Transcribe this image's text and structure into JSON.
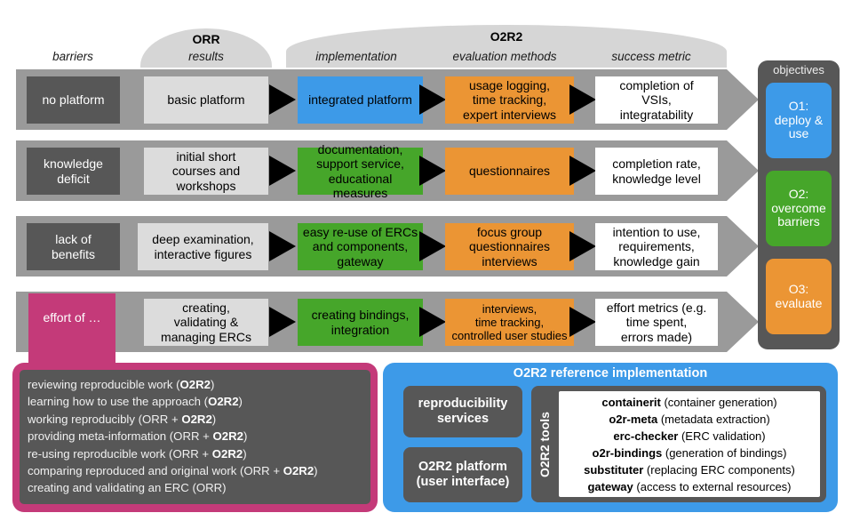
{
  "headers": {
    "groups": [
      {
        "label": "ORR"
      },
      {
        "label": "O2R2"
      }
    ],
    "columns": [
      {
        "label": "barriers"
      },
      {
        "label": "results"
      },
      {
        "label": "implementation"
      },
      {
        "label": "evaluation methods"
      },
      {
        "label": "success metric"
      }
    ]
  },
  "colors": {
    "blue": "#3d9ae8",
    "green": "#46a62a",
    "orange": "#eb9534",
    "magenta": "#c43a79",
    "dark_gray": "#575757",
    "light_gray": "#dcdcdc",
    "band_gray": "#9a9a9a",
    "hill_gray": "#d6d6d6"
  },
  "rows": [
    {
      "barrier": "no platform",
      "result": "basic platform",
      "implementation": "integrated platform",
      "evaluation": "usage logging,\ntime tracking,\nexpert interviews",
      "metric": "completion of\nVSIs,\nintegratability"
    },
    {
      "barrier": "knowledge\ndeficit",
      "result": "initial short\ncourses and\nworkshops",
      "implementation": "documentation,\nsupport service,\neducational measures",
      "evaluation": "questionnaires",
      "metric": "completion rate,\nknowledge level"
    },
    {
      "barrier": "lack of\nbenefits",
      "result": "deep examination,\ninteractive figures",
      "implementation": "easy re-use of ERCs\nand components,\ngateway",
      "evaluation": "focus group\nquestionnaires\ninterviews",
      "metric": "intention to use,\nrequirements,\nknowledge gain"
    },
    {
      "barrier": "effort of …",
      "result": "creating,\nvalidating &\nmanaging ERCs",
      "implementation": "creating bindings,\nintegration",
      "evaluation": "interviews,\ntime tracking,\ncontrolled user studies",
      "metric": "effort metrics (e.g.\ntime spent,\nerrors made)"
    }
  ],
  "objectives": {
    "title": "objectives",
    "items": [
      {
        "label": "O1:\ndeploy &\nuse",
        "color": "#3d9ae8"
      },
      {
        "label": "O2:\novercome\nbarriers",
        "color": "#46a62a"
      },
      {
        "label": "O3:\nevaluate",
        "color": "#eb9534"
      }
    ]
  },
  "effort_panel": {
    "items": [
      {
        "text": "reviewing reproducible work (",
        "bold": "O2R2",
        "tail": ")"
      },
      {
        "text": "learning how to use the approach (",
        "bold": "O2R2",
        "tail": ")"
      },
      {
        "text": "working reproducibly (ORR + ",
        "bold": "O2R2",
        "tail": ")"
      },
      {
        "text": "providing meta-information (ORR + ",
        "bold": "O2R2",
        "tail": ")"
      },
      {
        "text": "re-using reproducible work (ORR + ",
        "bold": "O2R2",
        "tail": ")"
      },
      {
        "text": "comparing reproduced and original work (ORR + ",
        "bold": "O2R2",
        "tail": ")"
      },
      {
        "text": "creating and validating an ERC (ORR)",
        "bold": "",
        "tail": ""
      }
    ]
  },
  "reference_implementation": {
    "title": "O2R2 reference implementation",
    "services_label": "reproducibility\nservices",
    "platform_label": "O2R2 platform\n(user interface)",
    "tools_label": "O2R2 tools",
    "tools": [
      {
        "name": "containerit",
        "desc": " (container generation)"
      },
      {
        "name": "o2r-meta",
        "desc": " (metadata extraction)"
      },
      {
        "name": "erc-checker",
        "desc": " (ERC validation)"
      },
      {
        "name": "o2r-bindings",
        "desc": " (generation of bindings)"
      },
      {
        "name": "substituter",
        "desc": " (replacing ERC components)"
      },
      {
        "name": "gateway",
        "desc": " (access to external resources)"
      }
    ]
  }
}
